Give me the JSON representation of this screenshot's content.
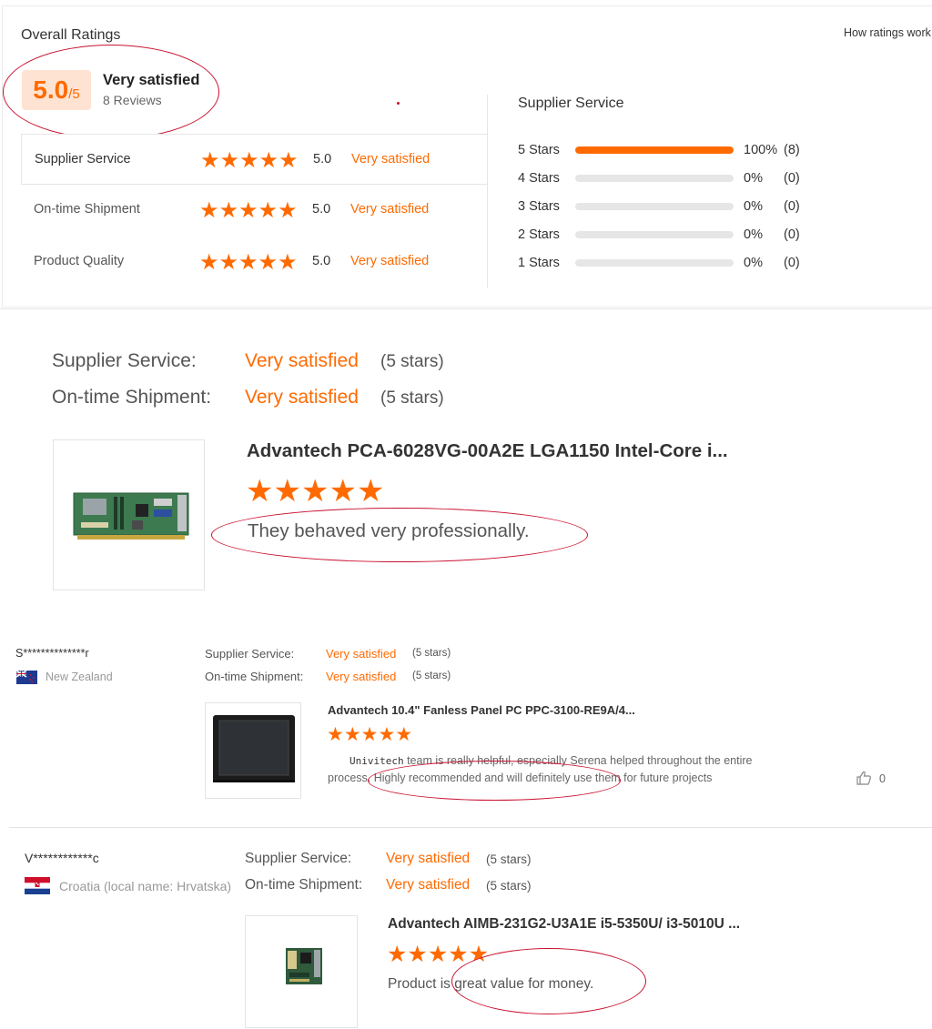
{
  "overall": {
    "title": "Overall Ratings",
    "how_link": "How ratings work",
    "score": "5.0",
    "score_out_of": "/5",
    "summary": "Very satisfied",
    "reviews": "8 Reviews",
    "rows": [
      {
        "label": "Supplier Service",
        "value": "5.0",
        "text": "Very satisfied"
      },
      {
        "label": "On-time Shipment",
        "value": "5.0",
        "text": "Very satisfied"
      },
      {
        "label": "Product Quality",
        "value": "5.0",
        "text": "Very satisfied"
      }
    ],
    "breakdown_title": "Supplier Service",
    "breakdown": [
      {
        "label": "5 Stars",
        "fraction": 1.0,
        "percent": "100%",
        "count": "(8)"
      },
      {
        "label": "4 Stars",
        "fraction": 0.0,
        "percent": "0%",
        "count": "(0)"
      },
      {
        "label": "3 Stars",
        "fraction": 0.0,
        "percent": "0%",
        "count": "(0)"
      },
      {
        "label": "2 Stars",
        "fraction": 0.0,
        "percent": "0%",
        "count": "(0)"
      },
      {
        "label": "1 Stars",
        "fraction": 0.0,
        "percent": "0%",
        "count": "(0)"
      }
    ]
  },
  "review1": {
    "service_label": "Supplier Service:",
    "service_value": "Very satisfied",
    "service_stars": "(5 stars)",
    "shipment_label": "On-time Shipment:",
    "shipment_value": "Very satisfied",
    "shipment_stars": "(5 stars)",
    "product": "Advantech PCA-6028VG-00A2E LGA1150 Intel-Core i...",
    "rating": 5,
    "comment": "They behaved very professionally."
  },
  "review2": {
    "user": "S**************r",
    "country": "New Zealand",
    "service_label": "Supplier Service:",
    "service_value": "Very satisfied",
    "service_stars": "(5 stars)",
    "shipment_label": "On-time Shipment:",
    "shipment_value": "Very satisfied",
    "shipment_stars": "(5 stars)",
    "product": "Advantech 10.4\" Fanless Panel PC PPC-3100-RE9A/4...",
    "rating": 5,
    "comment_brand": "Univitech",
    "comment_line1": " team is really helpful, especially Serena helped throughout the entire",
    "comment_line2": "process. Highly recommended and will definitely use them for future projects",
    "likes": "0"
  },
  "review3": {
    "user": "V************c",
    "country": "Croatia (local name: Hrvatska)",
    "service_label": "Supplier Service:",
    "service_value": "Very satisfied",
    "service_stars": "(5 stars)",
    "shipment_label": "On-time Shipment:",
    "shipment_value": "Very satisfied",
    "shipment_stars": "(5 stars)",
    "product": "Advantech AIMB-231G2-U3A1E i5-5350U/ i3-5010U ...",
    "rating": 5,
    "comment": "Product is great value for money."
  },
  "colors": {
    "accent": "#ff6a00",
    "annotation": "#c8102e",
    "bar_track": "#e6e6e6"
  }
}
